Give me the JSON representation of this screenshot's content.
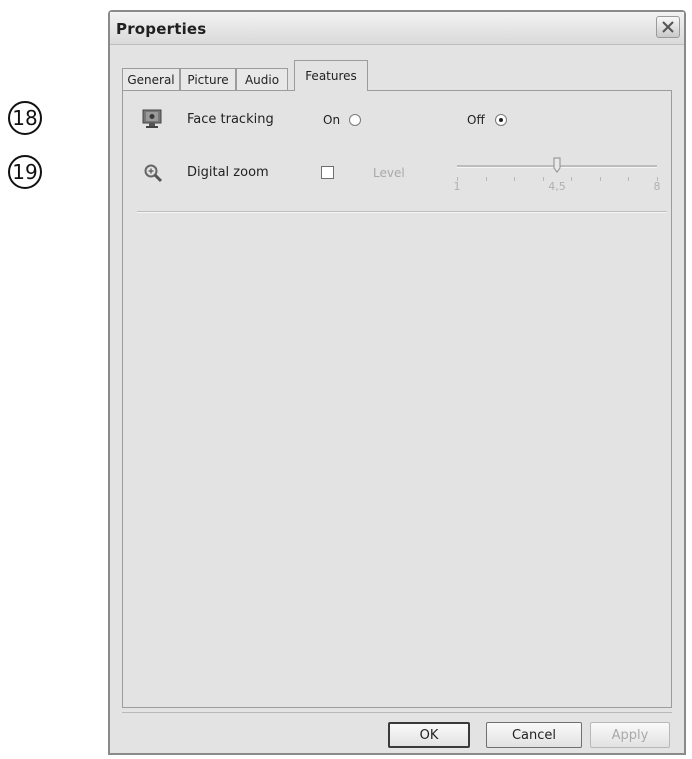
{
  "callouts": [
    {
      "number": "18",
      "target": "face-tracking"
    },
    {
      "number": "19",
      "target": "digital-zoom"
    }
  ],
  "dialog": {
    "title": "Properties",
    "close_icon": "close-x-icon"
  },
  "tabs": [
    {
      "label": "General",
      "active": false
    },
    {
      "label": "Picture",
      "active": false
    },
    {
      "label": "Audio",
      "active": false
    },
    {
      "label": "Features",
      "active": true
    }
  ],
  "features": {
    "face_tracking": {
      "icon": "face-tracking-monitor-icon",
      "label": "Face tracking",
      "on_label": "On",
      "off_label": "Off",
      "selected": "Off"
    },
    "digital_zoom": {
      "icon": "magnifier-zoom-icon",
      "label": "Digital zoom",
      "enabled": false,
      "level_label": "Level",
      "slider": {
        "min": 1,
        "max": 8,
        "value": 4.5,
        "tick_count": 8,
        "tick_labels": [
          "1",
          "4,5",
          "8"
        ]
      }
    }
  },
  "buttons": {
    "ok": "OK",
    "cancel": "Cancel",
    "apply": "Apply"
  },
  "colors": {
    "dialog_bg": "#e3e3e3",
    "border": "#8a8a8a",
    "disabled_text": "#a9a9a9"
  }
}
